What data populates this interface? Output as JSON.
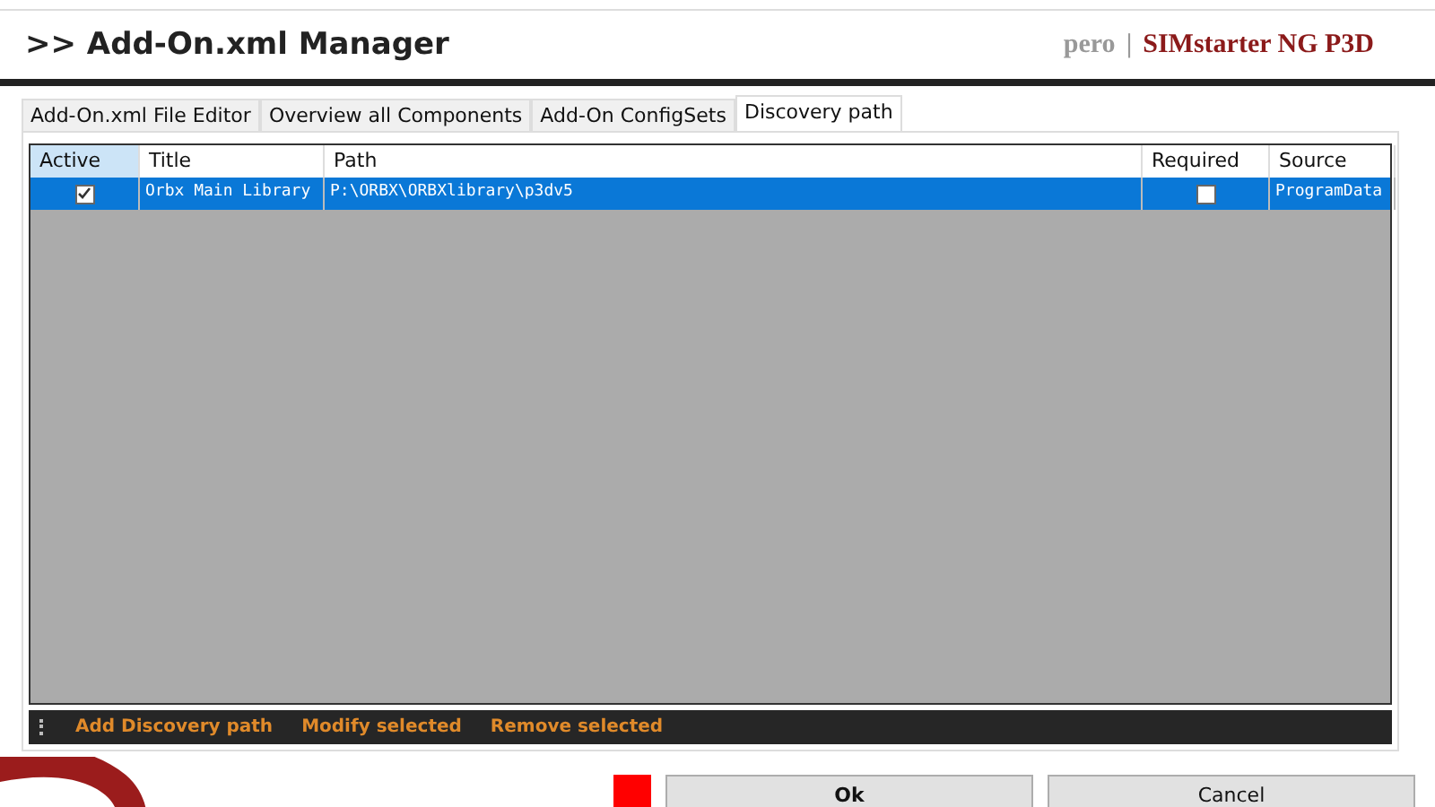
{
  "header": {
    "title": ">> Add-On.xml Manager",
    "user": "pero",
    "separator": "|",
    "product": "SIMstarter NG P3D"
  },
  "tabs": [
    {
      "label": "Add-On.xml File Editor",
      "selected": false
    },
    {
      "label": "Overview all Components",
      "selected": false
    },
    {
      "label": "Add-On ConfigSets",
      "selected": false
    },
    {
      "label": "Discovery path",
      "selected": true
    }
  ],
  "table": {
    "columns": [
      {
        "label": "Active",
        "selected": true
      },
      {
        "label": "Title",
        "selected": false
      },
      {
        "label": "Path",
        "selected": false
      },
      {
        "label": "Required",
        "selected": false
      },
      {
        "label": "Source",
        "selected": false
      }
    ],
    "rows": [
      {
        "active": true,
        "title": "Orbx Main Library",
        "path": "P:\\ORBX\\ORBXlibrary\\p3dv5",
        "required": false,
        "source": "ProgramData",
        "selected": true
      }
    ]
  },
  "toolbar": [
    "Add Discovery path",
    "Modify selected",
    "Remove selected"
  ],
  "buttons": [
    {
      "label": "Ok",
      "kind": "primary"
    },
    {
      "label": "Cancel",
      "kind": "normal"
    }
  ]
}
